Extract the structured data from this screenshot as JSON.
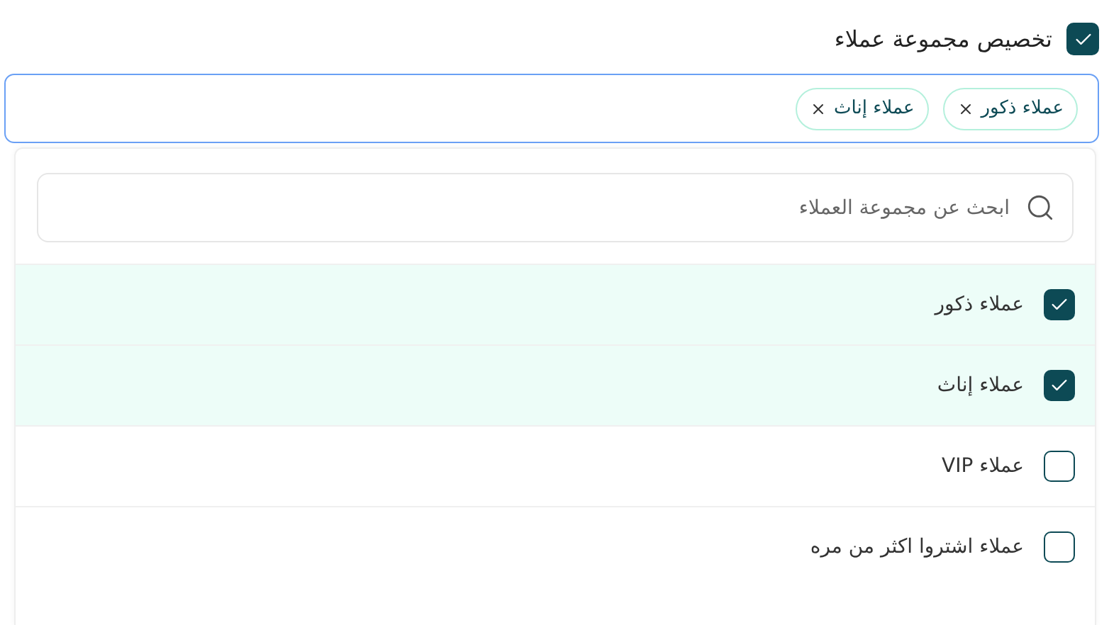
{
  "header": {
    "label": "تخصيص مجموعة عملاء",
    "checked": true
  },
  "chips": [
    {
      "label": "عملاء ذكور"
    },
    {
      "label": "عملاء إناث"
    }
  ],
  "search": {
    "placeholder": "ابحث عن مجموعة العملاء"
  },
  "options": [
    {
      "label": "عملاء ذكور",
      "checked": true
    },
    {
      "label": "عملاء إناث",
      "checked": true
    },
    {
      "label": "عملاء VIP",
      "checked": false
    },
    {
      "label": "عملاء اشتروا اكثر من مره",
      "checked": false
    }
  ]
}
